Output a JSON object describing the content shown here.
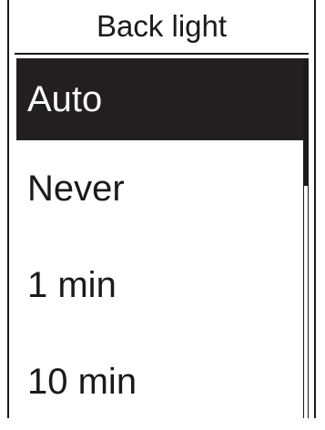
{
  "header": {
    "title": "Back light"
  },
  "menu": {
    "items": [
      {
        "label": "Auto",
        "selected": true
      },
      {
        "label": "Never",
        "selected": false
      },
      {
        "label": "1 min",
        "selected": false
      },
      {
        "label": "10 min",
        "selected": false
      }
    ]
  },
  "colors": {
    "selected_bg": "#231f20",
    "text": "#1a1a1a",
    "background": "#ffffff"
  }
}
